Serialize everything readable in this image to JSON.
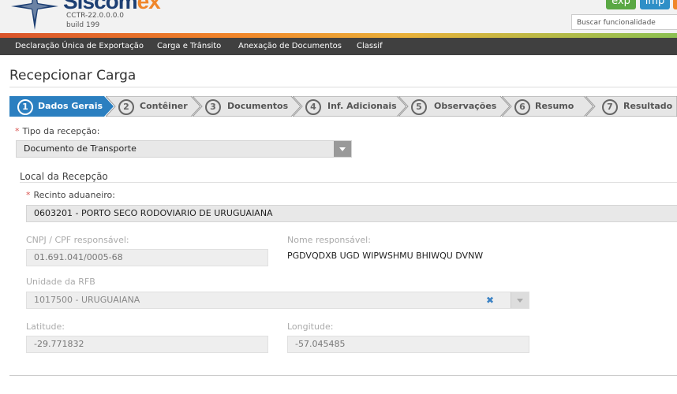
{
  "header": {
    "logo_main": "Siscom",
    "logo_accent": "ex",
    "version": "CCTR-22.0.0.0.0",
    "build": "build 199",
    "btn_exp": "exp",
    "btn_imp": "imp",
    "search_placeholder": "Buscar funcionalidade"
  },
  "nav": {
    "items": [
      "Declaração Única de Exportação",
      "Carga e Trânsito",
      "Anexação de Documentos",
      "Classif"
    ]
  },
  "page": {
    "title": "Recepcionar Carga"
  },
  "wizard": {
    "steps": [
      {
        "num": "1",
        "label": "Dados Gerais"
      },
      {
        "num": "2",
        "label": "Contêiner"
      },
      {
        "num": "3",
        "label": "Documentos"
      },
      {
        "num": "4",
        "label": "Inf. Adicionais"
      },
      {
        "num": "5",
        "label": "Observações"
      },
      {
        "num": "6",
        "label": "Resumo"
      },
      {
        "num": "7",
        "label": "Resultado"
      }
    ]
  },
  "form": {
    "required_mark": "*",
    "tipo_label": "Tipo da recepção:",
    "tipo_value": "Documento de Transporte",
    "section_local": "Local da Recepção",
    "recinto_label": "Recinto aduaneiro:",
    "recinto_value": "0603201 - PORTO SECO RODOVIARIO DE URUGUAIANA",
    "cnpj_label": "CNPJ / CPF responsável:",
    "cnpj_value": "01.691.041/0005-68",
    "nome_label": "Nome responsável:",
    "nome_value": "PGDVQDXB UGD WIPWSHMU BHIWQU DVNW",
    "unidade_label": "Unidade da RFB",
    "unidade_value": "1017500 - URUGUAIANA",
    "clear_symbol": "✖",
    "lat_label": "Latitude:",
    "lat_value": "-29.771832",
    "lon_label": "Longitude:",
    "lon_value": "-57.045485"
  },
  "colors": {
    "active_step": "#2b7fc0",
    "inactive_step": "#e6e6e6",
    "nav_bg": "#404040"
  }
}
